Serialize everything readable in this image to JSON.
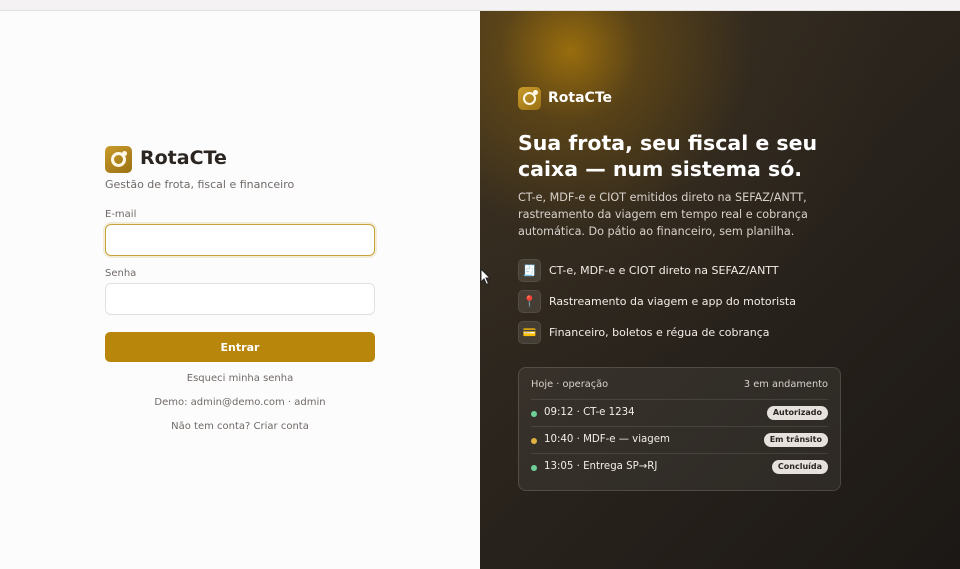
{
  "brand": {
    "name": "RotaCTe",
    "subtitle": "Gestão de frota, fiscal e financeiro"
  },
  "login": {
    "email_label": "E-mail",
    "email_value": "",
    "password_label": "Senha",
    "password_value": "",
    "submit_label": "Entrar",
    "forgot_label": "Esqueci minha senha",
    "demo_text": "Demo: admin@demo.com · admin",
    "signup_label": "Não tem conta? Criar conta"
  },
  "hero": {
    "brand_name": "RotaCTe",
    "headline": "Sua frota, seu fiscal e seu caixa — num sistema só.",
    "description": "CT-e, MDF-e e CIOT emitidos direto na SEFAZ/ANTT, rastreamento da viagem em tempo real e cobrança automática. Do pátio ao financeiro, sem planilha.",
    "features": [
      {
        "icon": "document-icon",
        "glyph": "🧾",
        "label": "CT-e, MDF-e e CIOT direto na SEFAZ/ANTT"
      },
      {
        "icon": "map-pin-icon",
        "glyph": "📍",
        "label": "Rastreamento da viagem e app do motorista"
      },
      {
        "icon": "credit-card-icon",
        "glyph": "💳",
        "label": "Financeiro, boletos e régua de cobrança"
      }
    ]
  },
  "operations": {
    "title": "Hoje · operação",
    "count_label": "3 em andamento",
    "rows": [
      {
        "text": "09:12 · CT-e 1234",
        "status": "Autorizado",
        "dot_color": "#6fcf97"
      },
      {
        "text": "10:40 · MDF-e — viagem",
        "status": "Em trânsito",
        "dot_color": "#e0b040"
      },
      {
        "text": "13:05 · Entrega SP→RJ",
        "status": "Concluída",
        "dot_color": "#6fcf97"
      }
    ]
  },
  "colors": {
    "accent": "#b8860b",
    "dark_panel": "#2a241d"
  }
}
